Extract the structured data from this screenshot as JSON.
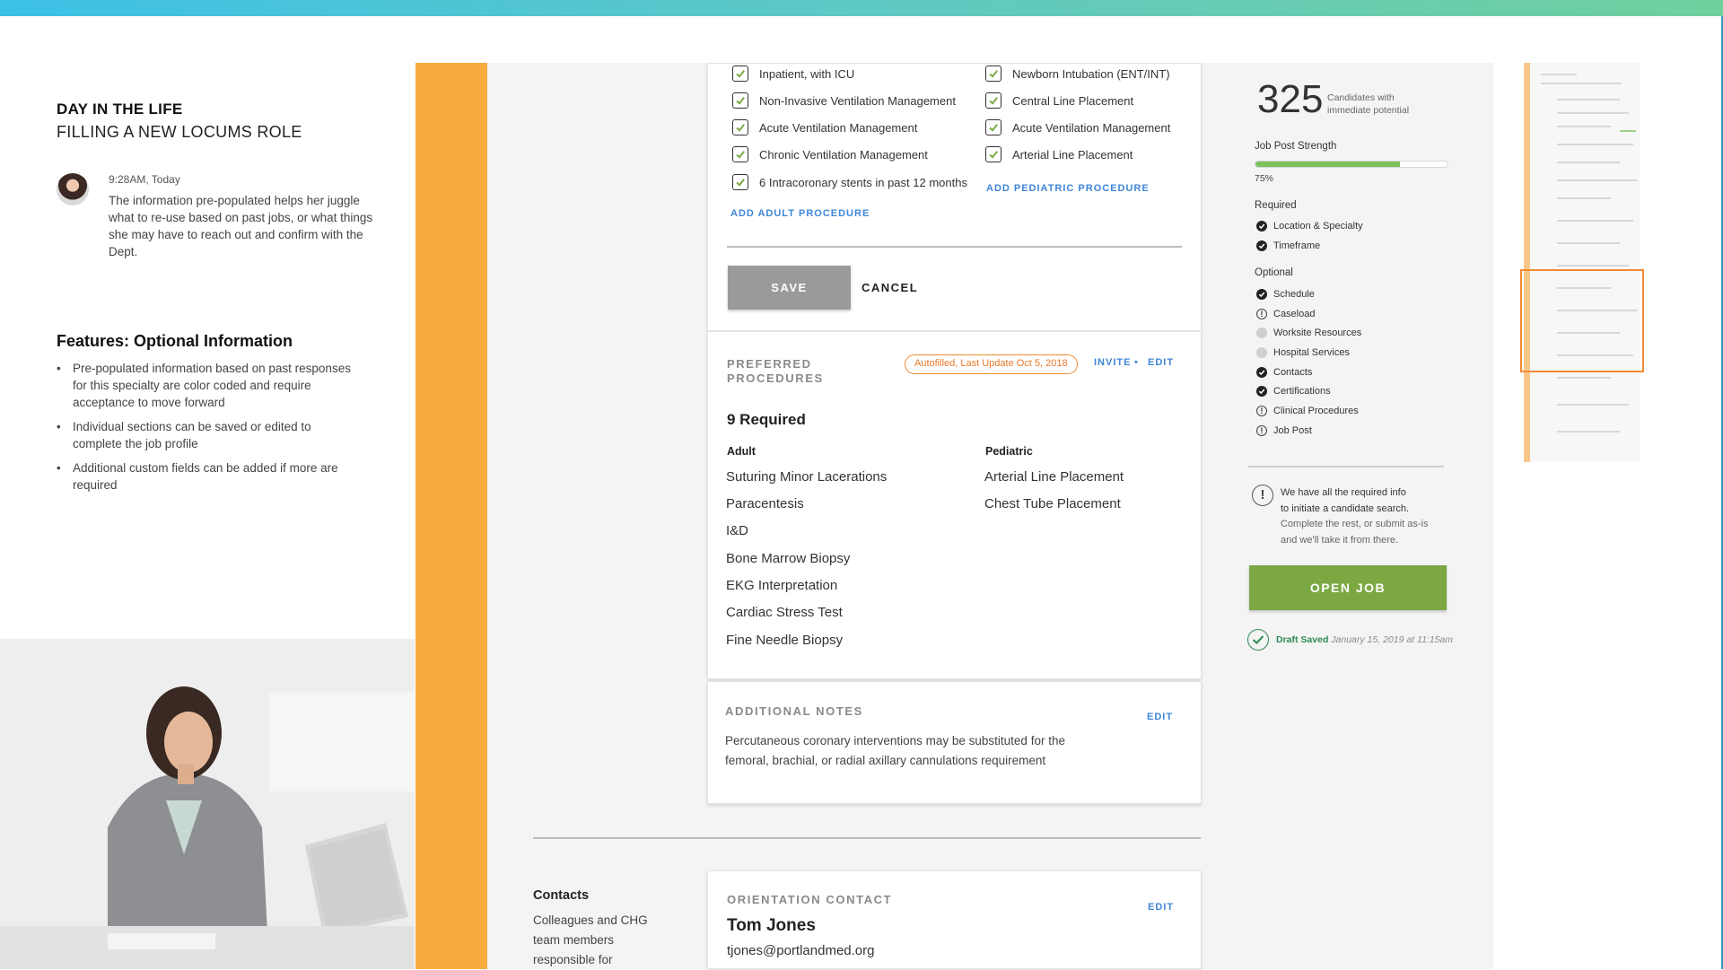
{
  "narrative": {
    "title": "DAY IN THE LIFE",
    "subtitle": "FILLING A NEW LOCUMS ROLE",
    "note_time": "9:28AM, Today",
    "note_text": "The information pre-populated helps her juggle what to re-use based on past jobs, or what things she may have to reach out and confirm with the Dept.",
    "features_title": "Features: Optional Information",
    "features": [
      "Pre-populated information based on past responses for this specialty are color coded and require acceptance to move forward",
      "Individual sections can be saved or edited to complete the job profile",
      "Additional custom fields can be added if more are required"
    ]
  },
  "procedures_edit": {
    "adult": [
      "Inpatient, with ICU",
      "Non-Invasive Ventilation Management",
      "Acute Ventilation Management",
      "Chronic Ventilation Management",
      "6 Intracoronary stents in past 12 months"
    ],
    "pediatric": [
      "Newborn Intubation (ENT/INT)",
      "Central Line Placement",
      "Acute Ventilation Management",
      "Arterial Line Placement"
    ],
    "add_adult": "ADD ADULT PROCEDURE",
    "add_pediatric": "ADD PEDIATRIC PROCEDURE",
    "save": "SAVE",
    "cancel": "CANCEL"
  },
  "preferred": {
    "label_line1": "PREFERRED",
    "label_line2": "PROCEDURES",
    "badge": "Autofilled, Last Update Oct 5, 2018",
    "invite": "INVITE",
    "dot": "•",
    "edit": "EDIT",
    "required": "9 Required",
    "adult_head": "Adult",
    "pediatric_head": "Pediatric",
    "adult": [
      "Suturing Minor Lacerations",
      "Paracentesis",
      "I&D",
      "Bone Marrow Biopsy",
      "EKG Interpretation",
      "Cardiac Stress Test",
      "Fine Needle Biopsy"
    ],
    "pediatric": [
      "Arterial Line Placement",
      "Chest Tube Placement"
    ]
  },
  "notes": {
    "label": "ADDITIONAL NOTES",
    "edit": "EDIT",
    "text": "Percutaneous coronary interventions may be substituted for the femoral, brachial, or radial axillary cannulations requirement"
  },
  "contacts": {
    "section_title": "Contacts",
    "section_desc": "Colleagues and CHG team members responsible for",
    "card_label": "ORIENTATION CONTACT",
    "edit": "EDIT",
    "name": "Tom Jones",
    "email": "tjones@portlandmed.org"
  },
  "summary": {
    "count": "325",
    "count_caption": "Candidates with immediate potential",
    "strength_label": "Job Post Strength",
    "strength_value": "75%",
    "strength_fraction": 0.75,
    "required_label": "Required",
    "required": [
      {
        "label": "Location & Specialty",
        "status": "done"
      },
      {
        "label": "Timeframe",
        "status": "done"
      }
    ],
    "optional_label": "Optional",
    "optional": [
      {
        "label": "Schedule",
        "status": "done"
      },
      {
        "label": "Caseload",
        "status": "warn"
      },
      {
        "label": "Worksite Resources",
        "status": "none"
      },
      {
        "label": "Hospital Services",
        "status": "none"
      },
      {
        "label": "Contacts",
        "status": "done"
      },
      {
        "label": "Certifications",
        "status": "done"
      },
      {
        "label": "Clinical Procedures",
        "status": "warn"
      },
      {
        "label": "Job Post",
        "status": "warn"
      }
    ],
    "info_line1": "We have all the required info",
    "info_line2": "to initiate a candidate search.",
    "info_rest": "Complete the rest, or submit as-is and we'll take it from there.",
    "open_job": "OPEN JOB",
    "draft_label": "Draft Saved",
    "draft_time": "January 15, 2019 at 11:15am"
  },
  "colors": {
    "accent_orange": "#f8ab3f",
    "link_blue": "#3f86d8",
    "primary_green": "#7ba843",
    "progress_green": "#7ac35d"
  }
}
